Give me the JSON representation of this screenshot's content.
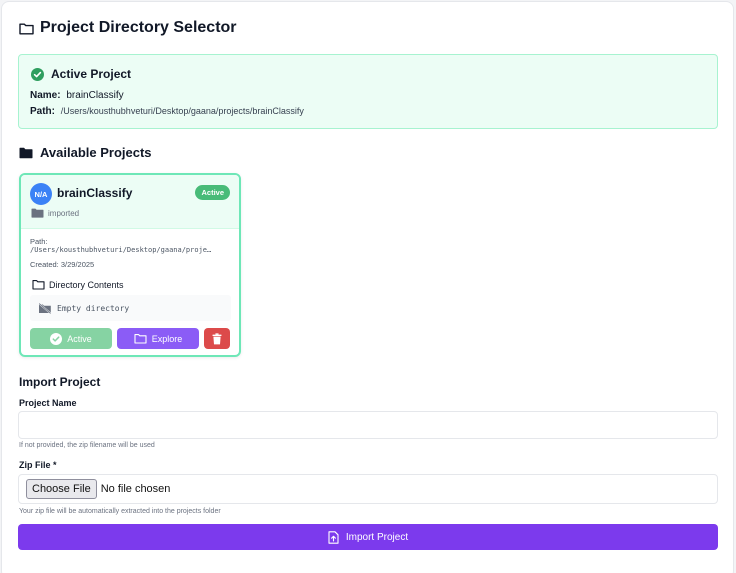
{
  "header": {
    "title": "Project Directory Selector",
    "icon": "folder-outline-icon"
  },
  "active_project": {
    "title": "Active Project",
    "name_label": "Name:",
    "name_value": "brainClassify",
    "path_label": "Path:",
    "path_value": "/Users/kousthubhveturi/Desktop/gaana/projects/brainClassify"
  },
  "available": {
    "title": "Available Projects",
    "projects": [
      {
        "avatar": "N/A",
        "name": "brainClassify",
        "badge": "Active",
        "type": "imported",
        "path_label": "Path:",
        "path_value": "/Users/kousthubhveturi/Desktop/gaana/proje…",
        "created": "Created: 3/29/2025",
        "dir_title": "Directory Contents",
        "empty_text": "Empty directory",
        "active_button": "Active",
        "explore_button": "Explore"
      }
    ]
  },
  "import": {
    "title": "Import Project",
    "name_label": "Project Name",
    "name_value": "",
    "name_hint": "If not provided, the zip filename will be used",
    "zip_label": "Zip File *",
    "choose_button": "Choose File",
    "no_file": "No file chosen",
    "zip_hint": "Your zip file will be automatically extracted into the projects folder",
    "submit": "Import Project"
  },
  "colors": {
    "accent": "#7c3aed",
    "success": "#48bb78",
    "danger": "#dc4a4a",
    "active_bg": "#ecfdf5"
  }
}
